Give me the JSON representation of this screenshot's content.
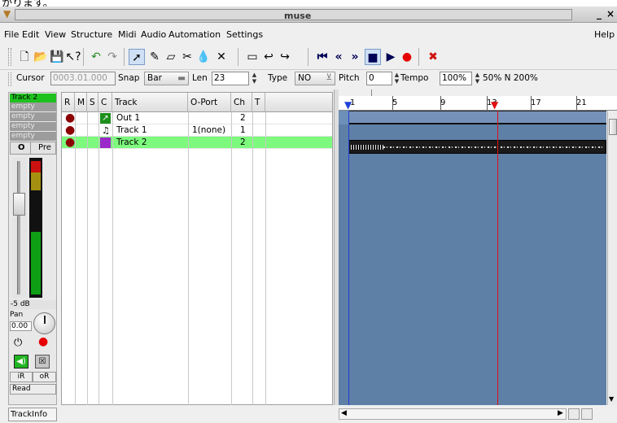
{
  "window": {
    "title": "muse",
    "cut_text": "かります。",
    "minimize": "_",
    "close": "×"
  },
  "menu": {
    "file": "File",
    "edit": "Edit",
    "view": "View",
    "structure": "Structure",
    "midi": "Midi",
    "audio": "Audio",
    "automation": "Automation",
    "settings": "Settings",
    "help": "Help"
  },
  "toolbar": {
    "cursor_label": "Cursor",
    "cursor_value": "0003.01.000",
    "snap_label": "Snap",
    "snap_value": "Bar",
    "len_label": "Len",
    "len_value": "23",
    "type_label": "Type",
    "type_value": "NO",
    "pitch_label": "Pitch",
    "pitch_value": "0",
    "tempo_label": "Tempo",
    "tempo_value": "100%",
    "speed_options": "50% N 200%"
  },
  "strip": {
    "slots": [
      "Track 2",
      "empty",
      "empty",
      "empty",
      "empty"
    ],
    "o_label": "O",
    "pre_label": "Pre",
    "db_label": "-5 dB",
    "pan_label": "Pan",
    "pan_value": "0.00",
    "ir_label": "iR",
    "or_label": "oR",
    "automation_mode": "Read",
    "meter_level": 0.6
  },
  "tracks": {
    "headers": {
      "r": "R",
      "m": "M",
      "s": "S",
      "c": "C",
      "track": "Track",
      "oport": "O-Port",
      "ch": "Ch",
      "t": "T"
    },
    "rows": [
      {
        "name": "Out 1",
        "oport": "",
        "ch": "2"
      },
      {
        "name": "Track 1",
        "oport": "1(none)",
        "ch": "1"
      },
      {
        "name": "Track 2",
        "oport": "",
        "ch": "2"
      }
    ]
  },
  "ruler": {
    "marks": [
      "1",
      "5",
      "9",
      "13",
      "17",
      "21"
    ]
  },
  "statusbar": {
    "trackinfo": "TrackInfo"
  }
}
